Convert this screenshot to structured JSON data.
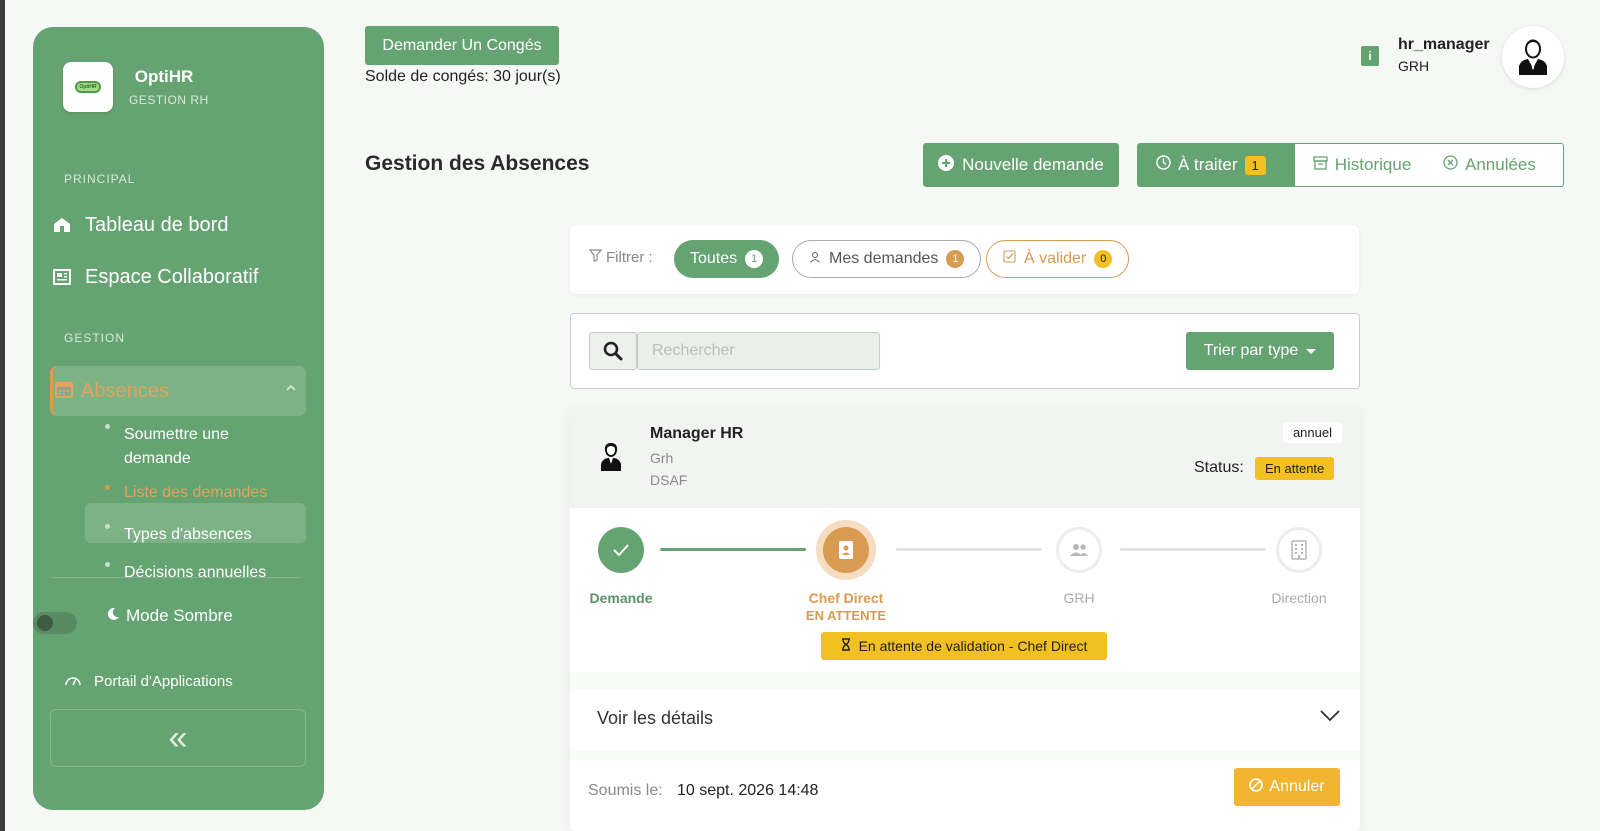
{
  "sidebar": {
    "brand": "OptiHR",
    "brand_sub": "GESTION RH",
    "logo_text": "OptiHR",
    "section_principal": "PRINCIPAL",
    "section_gestion": "GESTION",
    "nav": {
      "dashboard": "Tableau de bord",
      "collab": "Espace Collaboratif",
      "absences": "Absences"
    },
    "sub_items": {
      "submit_line1": "Soumettre une",
      "submit_line2": "demande",
      "list": "Liste des demandes",
      "types": "Types d'absences",
      "decisions": "Décisions annuelles"
    },
    "dark_mode": "Mode Sombre",
    "portal": "Portail d'Applications",
    "collapse_glyph": "«"
  },
  "topbar": {
    "request_leave_button": "Demander Un Congés",
    "balance": "Solde de congés: 30 jour(s)",
    "info_glyph": "i",
    "username": "hr_manager",
    "role": "GRH"
  },
  "page": {
    "title": "Gestion des Absences",
    "new_request_button": "Nouvelle demande",
    "tabs": {
      "todo": "À traiter",
      "todo_count": "1",
      "history": "Historique",
      "cancelled": "Annulées"
    }
  },
  "filter": {
    "label": "Filtrer :",
    "chips": {
      "all": "Toutes",
      "all_count": "1",
      "mine": "Mes demandes",
      "mine_count": "1",
      "validate": "À valider",
      "validate_count": "0"
    }
  },
  "search": {
    "placeholder": "Rechercher",
    "sort_button": "Trier par type"
  },
  "request": {
    "name": "Manager HR",
    "department": "Grh",
    "unit": "DSAF",
    "type": "annuel",
    "status_label": "Status:",
    "status": "En attente",
    "steps": {
      "demande": "Demande",
      "chef": "Chef Direct",
      "chef_state": "EN ATTENTE",
      "grh": "GRH",
      "direction": "Direction"
    },
    "pending_banner": "En attente de validation - Chef Direct",
    "details_label": "Voir les détails",
    "submitted_label": "Soumis le:",
    "submitted_value": "10 sept. 2026 14:48",
    "cancel_button": "Annuler"
  },
  "colors": {
    "primary": "#66a372",
    "accent_orange": "#d99a52",
    "warning_yellow": "#f2c021"
  }
}
